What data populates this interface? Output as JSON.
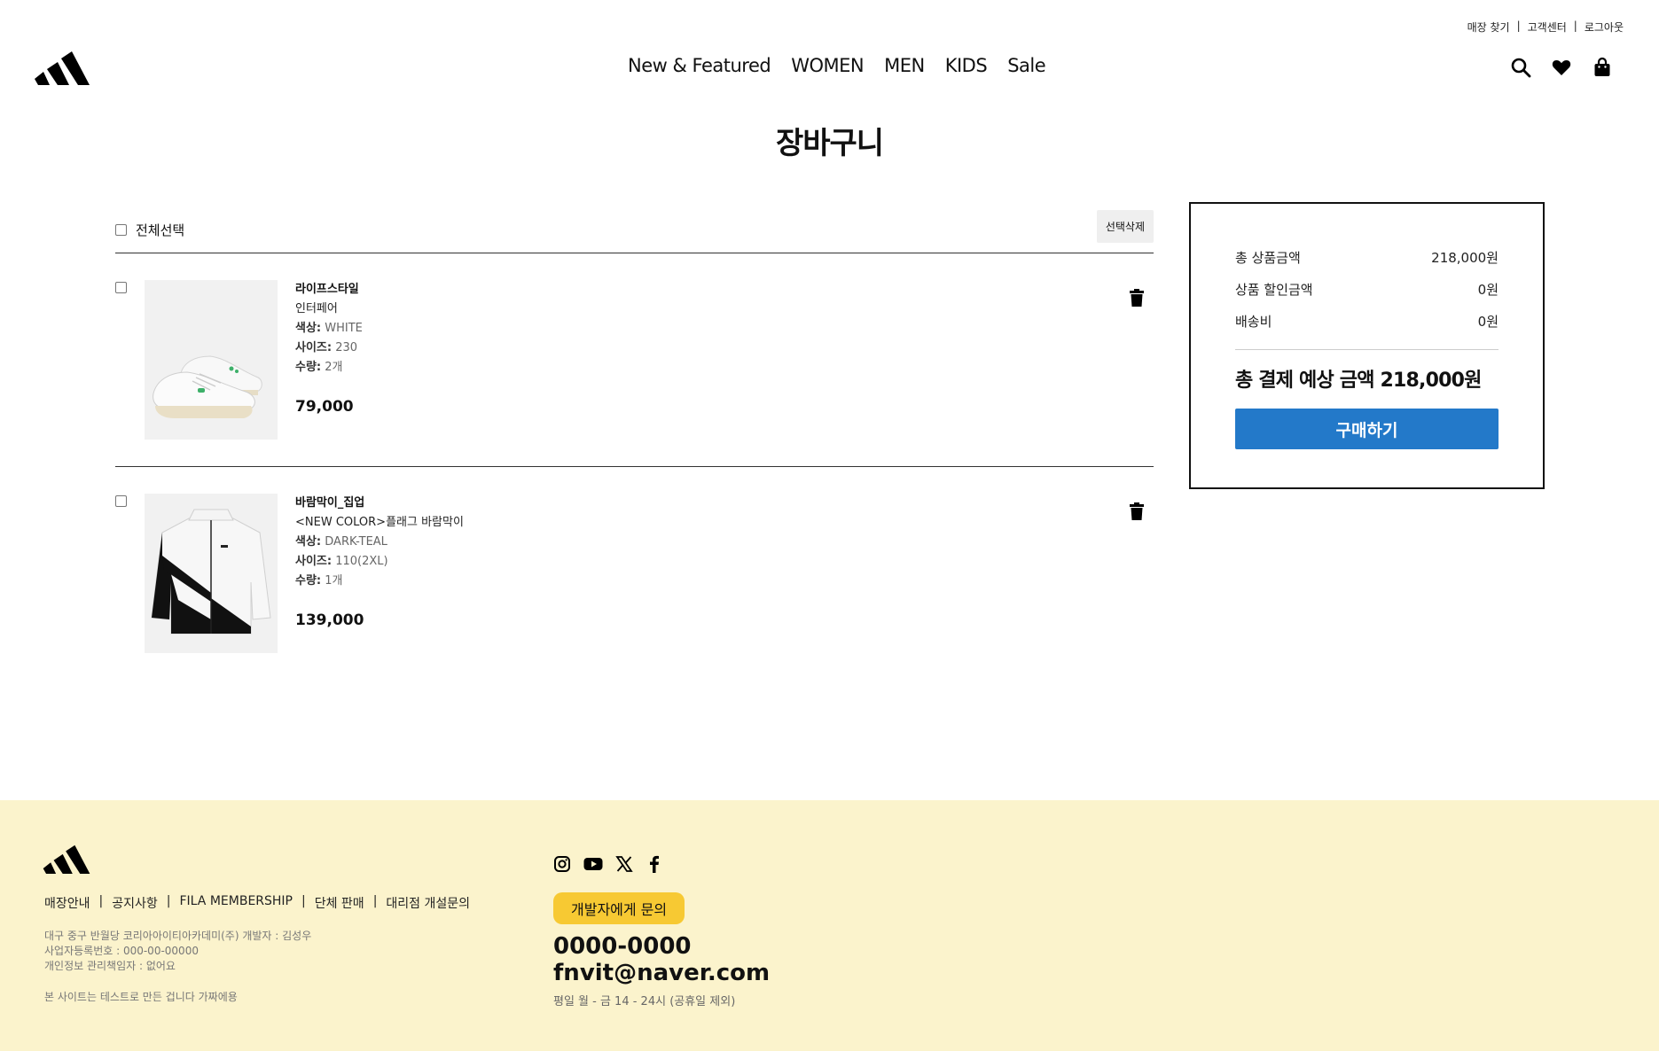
{
  "header": {
    "util_links": [
      "매장 찾기",
      "고객센터",
      "로그아웃"
    ],
    "nav": [
      "New & Featured",
      "WOMEN",
      "MEN",
      "KIDS",
      "Sale"
    ],
    "icons": [
      "search-icon",
      "heart-icon",
      "shopping-bag-icon"
    ]
  },
  "page": {
    "title": "장바구니"
  },
  "cart": {
    "select_all_label": "전체선택",
    "delete_selected_label": "선택삭제",
    "items": [
      {
        "name": "라이프스타일",
        "subtitle": "인터페어",
        "color_label": "색상:",
        "color": "WHITE",
        "size_label": "사이즈:",
        "size": "230",
        "qty_label": "수량:",
        "qty": "2개",
        "price": "79,000"
      },
      {
        "name": "바람막이_집업",
        "subtitle": "<NEW COLOR>플래그 바람막이",
        "color_label": "색상:",
        "color": "DARK-TEAL",
        "size_label": "사이즈:",
        "size": "110(2XL)",
        "qty_label": "수량:",
        "qty": "1개",
        "price": "139,000"
      }
    ]
  },
  "summary": {
    "rows": [
      {
        "label": "총 상품금액",
        "value": "218,000원"
      },
      {
        "label": "상품 할인금액",
        "value": "0원"
      },
      {
        "label": "배송비",
        "value": "0원"
      }
    ],
    "total_label": "총 결제 예상 금액",
    "total_value": "218,000원",
    "buy_label": "구매하기",
    "buy_color": "#2379c9"
  },
  "footer": {
    "bg_color": "#fbf3cc",
    "links": [
      "매장안내",
      "공지사항",
      "FILA MEMBERSHIP",
      "단체 판매",
      "대리점 개설문의"
    ],
    "info_lines": [
      "대구 중구 반월당 코리아아이티아카데미(주) 개발자 : 김성우",
      "사업자등록번호 : 000-00-00000",
      "개인정보 관리책임자 : 없어요"
    ],
    "note": "본 사이트는 테스트로 만든 겁니다 가짜에용",
    "social": [
      "instagram-icon",
      "youtube-icon",
      "x-icon",
      "facebook-icon"
    ],
    "contact_label": "개발자에게 문의",
    "phone": "0000-0000",
    "email": "fnvit@naver.com",
    "hours": "평일 월 - 금 14 - 24시 (공휴일 제외)"
  }
}
